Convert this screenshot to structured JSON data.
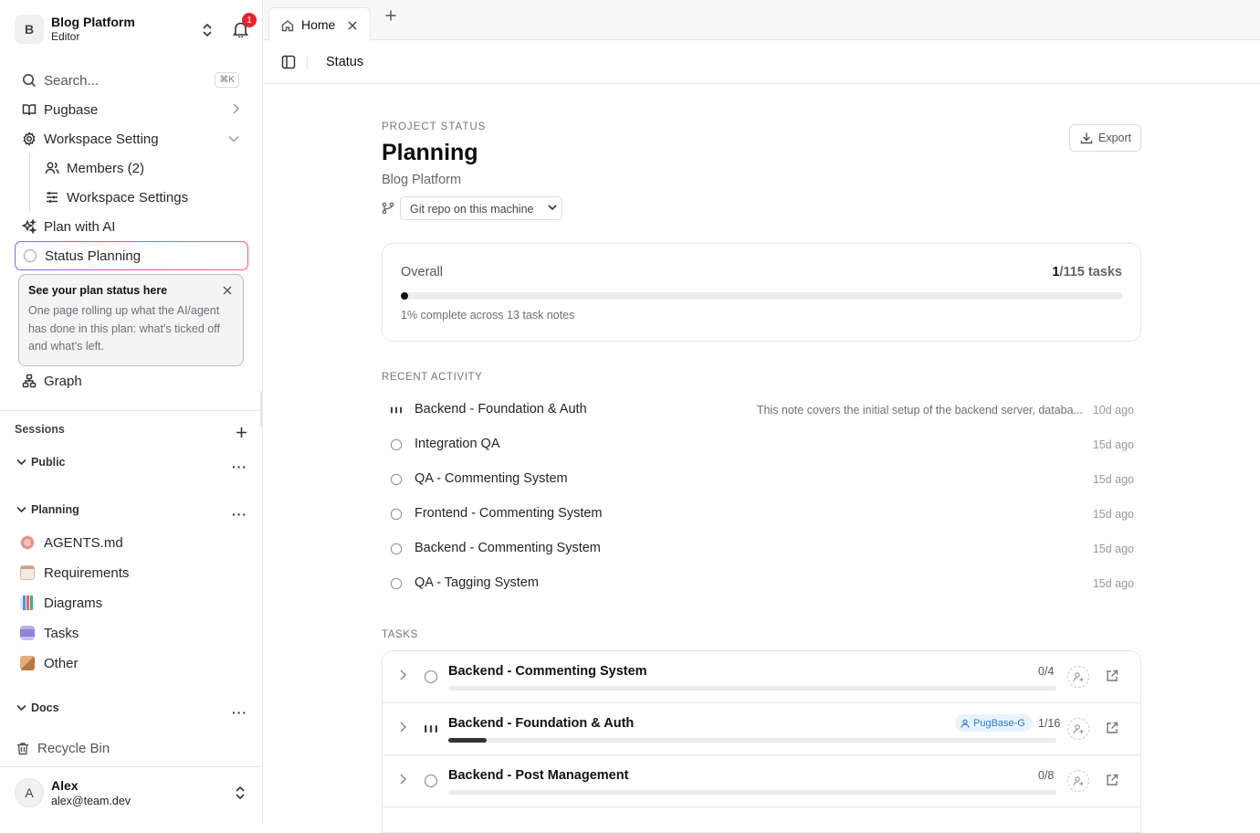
{
  "workspace": {
    "initial": "B",
    "name": "Blog Platform",
    "role": "Editor",
    "notifications": "1"
  },
  "search": {
    "placeholder": "Search...",
    "shortcut": "⌘K"
  },
  "nav": {
    "pugbase": "Pugbase",
    "workspace_setting": "Workspace Setting",
    "members": "Members (2)",
    "workspace_settings": "Workspace Settings",
    "plan_with_ai": "Plan with AI",
    "status_planning": "Status Planning",
    "graph": "Graph"
  },
  "tooltip": {
    "title": "See your plan status here",
    "body": "One page rolling up what the AI/agent has done in this plan: what's ticked off and what's left."
  },
  "sessions": {
    "label": "Sessions"
  },
  "groups": {
    "public": "Public",
    "planning": "Planning",
    "docs": "Docs"
  },
  "planning_docs": [
    {
      "label": "AGENTS.md",
      "icon": "compass-emoji",
      "color": "#e8a0a0"
    },
    {
      "label": "Requirements",
      "icon": "clipboard-emoji",
      "color": "#d9b8a0"
    },
    {
      "label": "Diagrams",
      "icon": "bar-chart-emoji",
      "color": "#6a9bd8"
    },
    {
      "label": "Tasks",
      "icon": "robot-emoji",
      "color": "#9a8fe0"
    },
    {
      "label": "Other",
      "icon": "package-emoji",
      "color": "#c8905a"
    }
  ],
  "recycle_bin": "Recycle Bin",
  "user": {
    "initial": "A",
    "name": "Alex",
    "email": "alex@team.dev"
  },
  "tabs": [
    {
      "label": "Home"
    }
  ],
  "breadcrumb": "Status",
  "page": {
    "eyebrow": "PROJECT STATUS",
    "title": "Planning",
    "project": "Blog Platform",
    "export_label": "Export",
    "repo_select": "Git repo on this machine"
  },
  "overall": {
    "label": "Overall",
    "done": "1",
    "total": "/115 tasks",
    "progress": 0.01,
    "note": "1% complete across 13 task notes"
  },
  "recent_activity": {
    "label": "RECENT ACTIVITY",
    "items": [
      {
        "name": "Backend - Foundation & Auth",
        "status": "in-progress",
        "desc": "This note covers the initial setup of the backend server, databa...",
        "ago": "10d ago"
      },
      {
        "name": "Integration QA",
        "status": "todo",
        "desc": "",
        "ago": "15d ago"
      },
      {
        "name": "QA - Commenting System",
        "status": "todo",
        "desc": "",
        "ago": "15d ago"
      },
      {
        "name": "Frontend - Commenting System",
        "status": "todo",
        "desc": "",
        "ago": "15d ago"
      },
      {
        "name": "Backend - Commenting System",
        "status": "todo",
        "desc": "",
        "ago": "15d ago"
      },
      {
        "name": "QA - Tagging System",
        "status": "todo",
        "desc": "",
        "ago": "15d ago"
      }
    ]
  },
  "tasks": {
    "label": "TASKS",
    "items": [
      {
        "name": "Backend - Commenting System",
        "status": "todo",
        "count": "0/4",
        "progress": 0,
        "tag": ""
      },
      {
        "name": "Backend - Foundation & Auth",
        "status": "in-progress",
        "count": "1/16",
        "progress": 0.0625,
        "tag": "PugBase-G"
      },
      {
        "name": "Backend - Post Management",
        "status": "todo",
        "count": "0/8",
        "progress": 0,
        "tag": ""
      }
    ]
  },
  "colors": {
    "accent_gradient": [
      "#7c6cf2",
      "#d94fb8",
      "#f25c7a"
    ],
    "notification_badge": "#e5252a",
    "tag_bg": "#e9f3fd",
    "tag_fg": "#2a7bc6"
  }
}
